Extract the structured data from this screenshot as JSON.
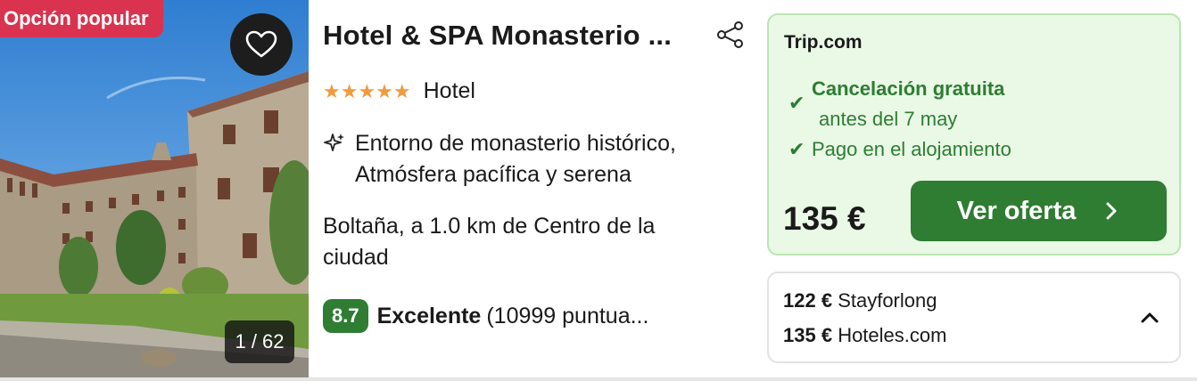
{
  "photo": {
    "badge": "Opción popular",
    "counter": "1 / 62",
    "favorite_icon": "heart-icon"
  },
  "info": {
    "title": "Hotel & SPA Monasterio ...",
    "share_icon": "share-icon",
    "stars": "★★★★★",
    "star_count": 5,
    "type": "Hotel",
    "highlight_icon": "sparkle-icon",
    "highlight_line1": "Entorno de monasterio histórico,",
    "highlight_line2": "Atmósfera pacífica y serena",
    "location": "Boltaña, a 1.0 km de Centro de la ciudad",
    "score": "8.7",
    "rating_label": "Excelente",
    "rating_count": "(10999 puntua..."
  },
  "offer": {
    "provider": "Trip.com",
    "cancel_title": "Cancelación gratuita",
    "cancel_sub": "antes del 7 may",
    "payment": "Pago en el alojamiento",
    "price": "135 €",
    "cta": "Ver oferta"
  },
  "alternatives": [
    {
      "price": "122 €",
      "provider": "Stayforlong"
    },
    {
      "price": "135 €",
      "provider": "Hoteles.com"
    }
  ],
  "colors": {
    "accent_green": "#2e7d32",
    "badge_red": "#d9334f",
    "offer_bg": "#e9f9e6",
    "star_orange": "#f19a3e"
  }
}
